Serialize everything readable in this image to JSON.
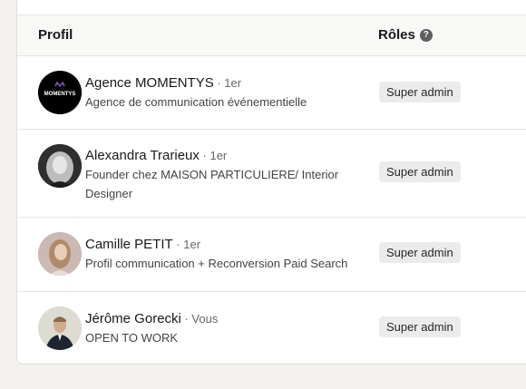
{
  "header": {
    "profil_label": "Profil",
    "roles_label": "Rôles",
    "help_glyph": "?"
  },
  "rows": [
    {
      "name": "Agence MOMENTYS",
      "degree": " · 1er",
      "headline": "Agence de communication événementielle",
      "role": "Super admin",
      "logo_text": "MOMENTYS"
    },
    {
      "name": "Alexandra Trarieux",
      "degree": " · 1er",
      "headline": "Founder chez MAISON PARTICULIERE/ Interior Designer",
      "role": "Super admin"
    },
    {
      "name": "Camille PETIT",
      "degree": " · 1er",
      "headline": "Profil communication + Reconversion Paid Search",
      "role": "Super admin"
    },
    {
      "name": "Jérôme Gorecki",
      "degree": " · Vous",
      "headline": "OPEN TO WORK",
      "role": "Super admin"
    }
  ]
}
